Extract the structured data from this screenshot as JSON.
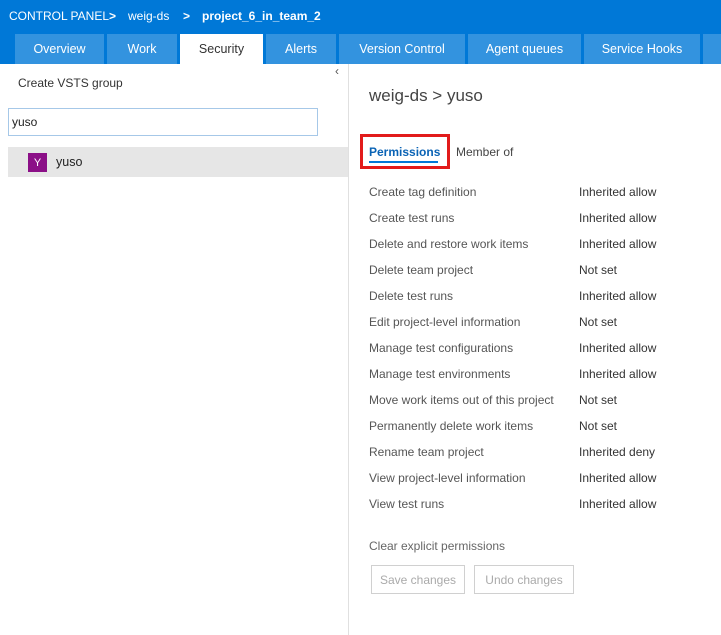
{
  "breadcrumb": {
    "root": "CONTROL PANEL",
    "sep": ">",
    "collection": "weig-ds",
    "project": "project_6_in_team_2"
  },
  "tabs": [
    {
      "label": "Overview",
      "active": false
    },
    {
      "label": "Work",
      "active": false
    },
    {
      "label": "Security",
      "active": true
    },
    {
      "label": "Alerts",
      "active": false
    },
    {
      "label": "Version Control",
      "active": false
    },
    {
      "label": "Agent queues",
      "active": false
    },
    {
      "label": "Service Hooks",
      "active": false
    }
  ],
  "left": {
    "collapse_glyph": "‹",
    "create_group_label": "Create VSTS group",
    "search_value": "yuso",
    "result": {
      "initial": "Y",
      "name": "yuso",
      "avatar_color": "#8b0f87"
    }
  },
  "right": {
    "title": "weig-ds > yuso",
    "tabs": {
      "permissions": "Permissions",
      "member_of": "Member of"
    },
    "permissions": [
      {
        "name": "Create tag definition",
        "value": "Inherited allow"
      },
      {
        "name": "Create test runs",
        "value": "Inherited allow"
      },
      {
        "name": "Delete and restore work items",
        "value": "Inherited allow"
      },
      {
        "name": "Delete team project",
        "value": "Not set"
      },
      {
        "name": "Delete test runs",
        "value": "Inherited allow"
      },
      {
        "name": "Edit project-level information",
        "value": "Not set"
      },
      {
        "name": "Manage test configurations",
        "value": "Inherited allow"
      },
      {
        "name": "Manage test environments",
        "value": "Inherited allow"
      },
      {
        "name": "Move work items out of this project",
        "value": "Not set"
      },
      {
        "name": "Permanently delete work items",
        "value": "Not set"
      },
      {
        "name": "Rename team project",
        "value": "Inherited deny"
      },
      {
        "name": "View project-level information",
        "value": "Inherited allow"
      },
      {
        "name": "View test runs",
        "value": "Inherited allow"
      }
    ],
    "clear_label": "Clear explicit permissions",
    "save_label": "Save changes",
    "undo_label": "Undo changes"
  },
  "colors": {
    "header_blue": "#0078d7",
    "tab_blue": "#3393df",
    "highlight_red": "#e21b1b",
    "link_blue": "#0a63b5"
  }
}
